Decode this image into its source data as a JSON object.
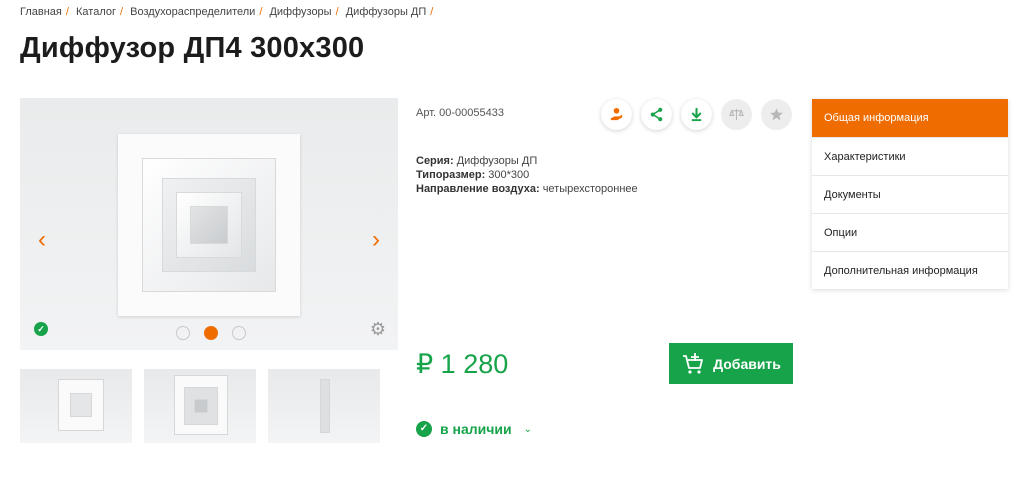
{
  "breadcrumb": [
    "Главная",
    "Каталог",
    "Воздухораспределители",
    "Диффузоры",
    "Диффузоры ДП"
  ],
  "breadcrumb_separator": "/",
  "title": "Диффузор ДП4 300x300",
  "article": "Арт. 00-00055433",
  "actions": [
    {
      "icon": "hand-coin-icon",
      "state": "active"
    },
    {
      "icon": "share-icon",
      "state": "active"
    },
    {
      "icon": "download-icon",
      "state": "active"
    },
    {
      "icon": "compare-scales-icon",
      "state": "inactive"
    },
    {
      "icon": "star-icon",
      "state": "inactive"
    }
  ],
  "specs": [
    {
      "label": "Серия:",
      "value": "Диффузоры ДП"
    },
    {
      "label": "Типоразмер:",
      "value": "300*300"
    },
    {
      "label": "Направление воздуха:",
      "value": "четырехстороннее"
    }
  ],
  "gallery": {
    "prev_icon": "‹",
    "next_icon": "›",
    "slides_count": 3,
    "active_slide": 2
  },
  "price": "₽ 1 280",
  "add_button": "Добавить",
  "stock": {
    "label": "в наличии",
    "chevron": "⌄"
  },
  "tabs": [
    "Общая информация",
    "Характеристики",
    "Документы",
    "Опции",
    "Дополнительная информация"
  ],
  "active_tab": 0,
  "colors": {
    "accent": "#ef6c00",
    "green": "#17a34a"
  }
}
